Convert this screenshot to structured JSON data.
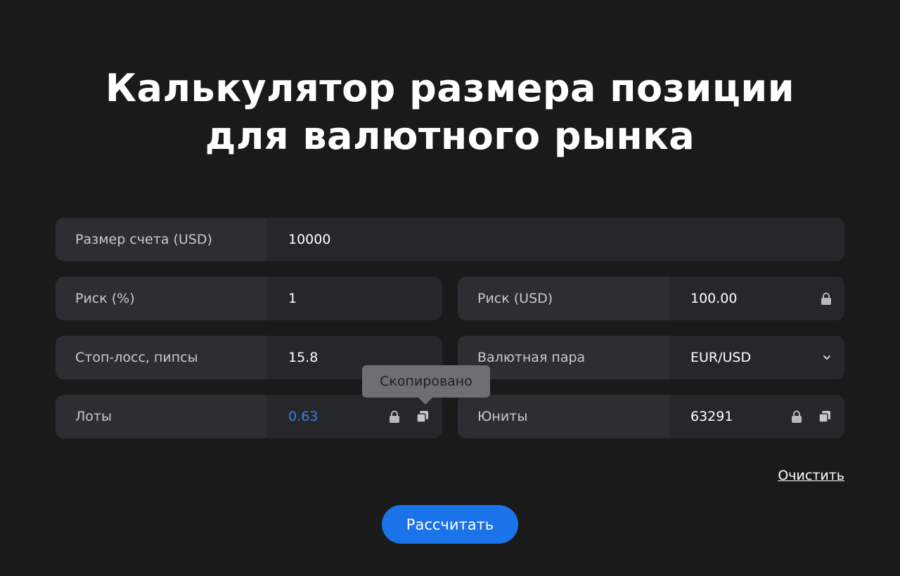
{
  "title": {
    "line1": "Калькулятор размера позиции",
    "line2": "для валютного рынка"
  },
  "fields": {
    "account_size": {
      "label": "Размер счета (USD)",
      "value": "10000"
    },
    "risk_percent": {
      "label": "Риск (%)",
      "value": "1"
    },
    "risk_usd": {
      "label": "Риск (USD)",
      "value": "100.00",
      "locked": true
    },
    "stop_loss": {
      "label": "Стоп-лосс, пипсы",
      "value": "15.8"
    },
    "currency_pair": {
      "label": "Валютная пара",
      "value": "EUR/USD"
    },
    "lots": {
      "label": "Лоты",
      "value": "0.63",
      "locked": true
    },
    "units": {
      "label": "Юниты",
      "value": "63291",
      "locked": true
    }
  },
  "tooltip": {
    "text": "Скопировано"
  },
  "actions": {
    "clear_label": "Очистить",
    "calculate_label": "Рассчитать"
  },
  "colors": {
    "background": "#1a1a1b",
    "field_label_bg": "#2d2e31",
    "field_value_bg": "#26272a",
    "accent": "#1a73e8",
    "lots_value": "#3a7fe0"
  },
  "icons": {
    "lock": "lock-icon",
    "copy": "copy-icon",
    "dropdown": "chevron-down-icon"
  }
}
